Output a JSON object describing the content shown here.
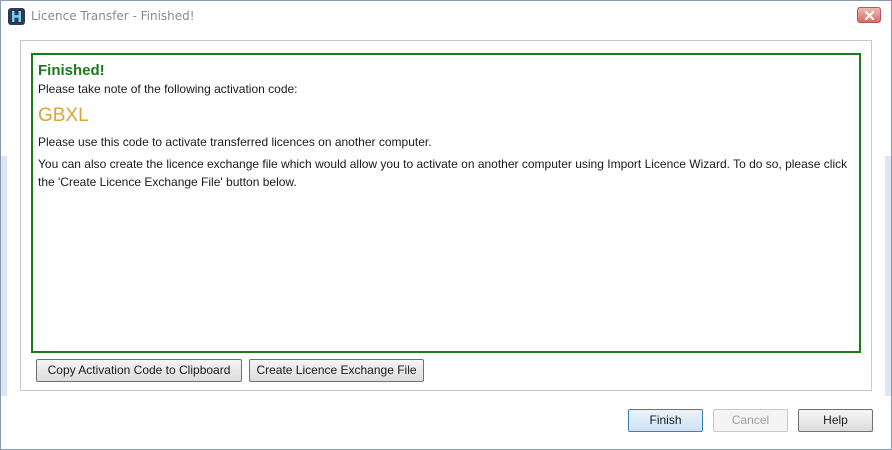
{
  "window": {
    "title": "Licence Transfer - Finished!"
  },
  "content": {
    "heading": "Finished!",
    "note": "Please take note of the following activation code:",
    "activation_code": "GBXL",
    "instruction": "Please use this code to activate transferred licences on another computer.",
    "exchange_info": "You can also create the licence exchange file which would allow you to activate on another computer using Import Licence Wizard. To do so, please click the 'Create Licence Exchange File' button below."
  },
  "actions": {
    "copy_label": "Copy Activation Code to Clipboard",
    "create_label": "Create Licence Exchange File"
  },
  "footer": {
    "finish_label": "Finish",
    "cancel_label": "Cancel",
    "help_label": "Help"
  },
  "colors": {
    "success_green": "#1b7a1b",
    "code_gold": "#d9a43a"
  },
  "icons": {
    "app": "app-logo-icon",
    "close": "close-icon"
  }
}
